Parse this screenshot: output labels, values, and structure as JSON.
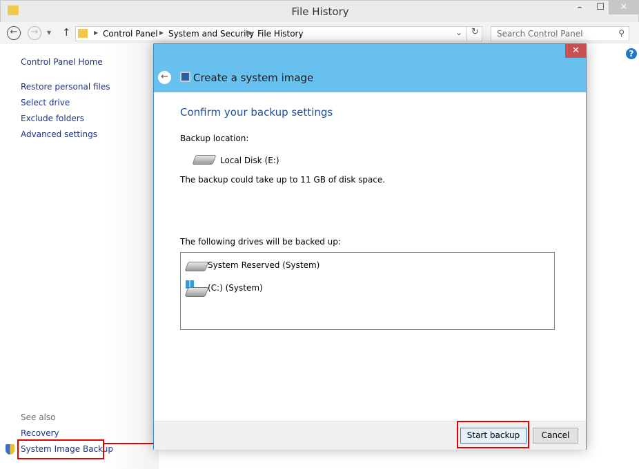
{
  "window": {
    "title": "File History",
    "minimize": "–",
    "maximize": "☐",
    "close": "✕"
  },
  "nav": {
    "back": "←",
    "forward": "→",
    "recent": "▾",
    "up": "↑",
    "breadcrumb": [
      "Control Panel",
      "System and Security",
      "File History"
    ],
    "dropdown": "⌄",
    "refresh": "↻",
    "search_placeholder": "Search Control Panel",
    "search_icon": "⚲",
    "help": "?"
  },
  "sidebar": {
    "home": "Control Panel Home",
    "items": [
      "Restore personal files",
      "Select drive",
      "Exclude folders",
      "Advanced settings"
    ],
    "see_also": "See also",
    "see_also_items": [
      "Recovery",
      "System Image Backup"
    ]
  },
  "dialog": {
    "title": "Create a system image",
    "close": "✕",
    "heading": "Confirm your backup settings",
    "backup_location_label": "Backup location:",
    "location": "Local Disk (E:)",
    "space_note": "The backup could take up to 11 GB of disk space.",
    "drives_label": "The following drives will be backed up:",
    "drives": [
      "System Reserved (System)",
      "(C:) (System)"
    ],
    "start_button": "Start backup",
    "cancel_button": "Cancel"
  },
  "colors": {
    "dialog_header": "#68c0ee",
    "heading": "#1e4e9a",
    "highlight": "#e00000",
    "close": "#c75050"
  }
}
